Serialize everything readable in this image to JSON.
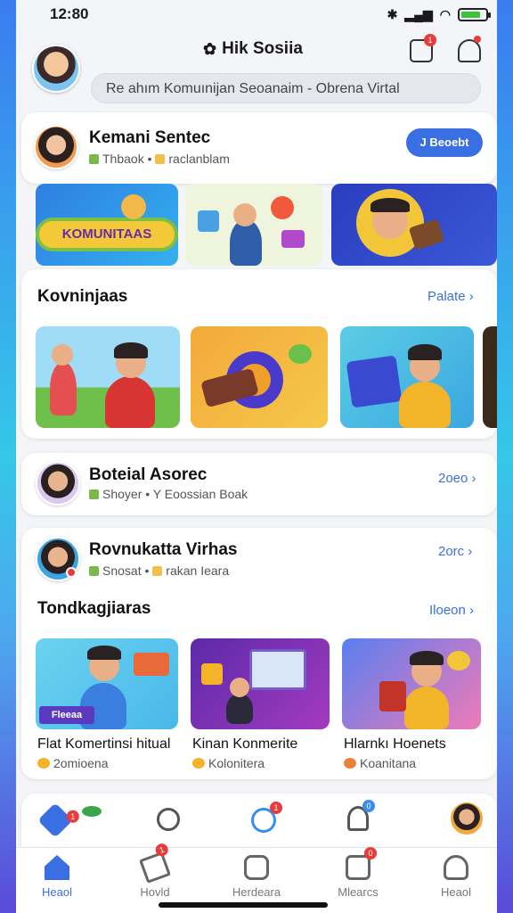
{
  "status": {
    "time": "12:80"
  },
  "header": {
    "brand": "Hik Sosiia",
    "search_placeholder": "Re ahım Komuınijan Seoanaim  -  Obrena Virtal",
    "notif_badge": "1"
  },
  "profile_card": {
    "name": "Kemani Sentec",
    "sub1": "Thbaok",
    "sub2": "raclanblam",
    "button": "J Beoebt"
  },
  "banners": [
    "KOMUNITAAS"
  ],
  "communities": {
    "title": "Kovninjaas",
    "link": "Palate"
  },
  "contacts": [
    {
      "name": "Boteial Asorec",
      "sub1": "Shoyer",
      "sub2": "Y Eoossian Boak",
      "link": "2oeo"
    },
    {
      "name": "Rovnukatta Virhas",
      "sub1": "Snosat",
      "sub2": "rakan Ieara",
      "link": "2orc"
    }
  ],
  "trending": {
    "title": "Tondkagjiaras",
    "link": "Iloeon",
    "tiles": [
      {
        "label": "Flat Komertinsi hitual",
        "sub": "2omioena",
        "tag": "Fleeaa"
      },
      {
        "label": "Kinan Konmerite",
        "sub": "Kolonitera"
      },
      {
        "label": "Hlarnkı Hoenets",
        "sub": "Koanitana"
      }
    ]
  },
  "quick_icons": {
    "badges": [
      "1",
      "1",
      "0"
    ]
  },
  "tabs": [
    {
      "label": "Heaol",
      "active": true
    },
    {
      "label": "Hovld",
      "badge": "1"
    },
    {
      "label": "Herdeara"
    },
    {
      "label": "Mlearcs",
      "badge": "0"
    },
    {
      "label": "Heaol"
    }
  ],
  "colors": {
    "accent": "#3a6fe3",
    "badge": "#e73c3c",
    "background": "#f3f5f9"
  }
}
